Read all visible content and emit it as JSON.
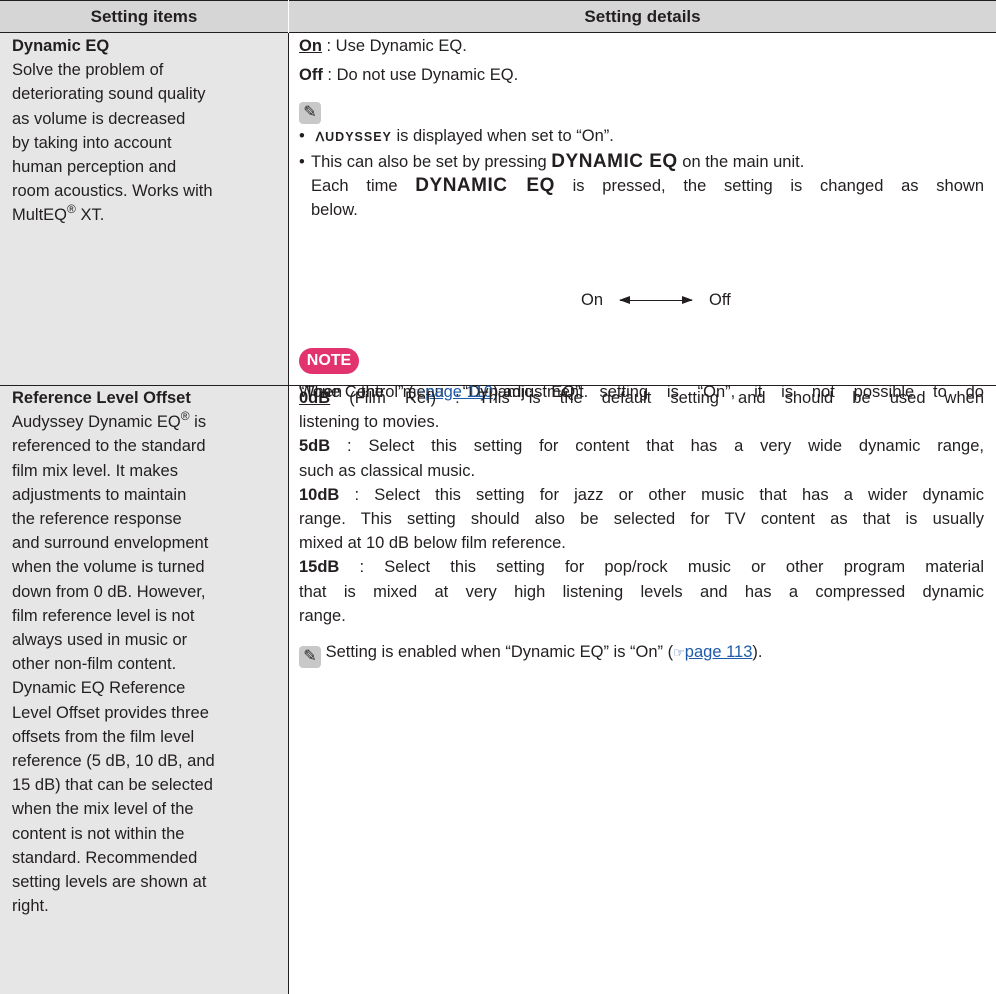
{
  "header": {
    "col1": "Setting items",
    "col2": "Setting details"
  },
  "row1": {
    "left": {
      "title": "Dynamic EQ",
      "lines": [
        "Solve the problem of",
        "deteriorating sound quality",
        "as volume is decreased",
        "by taking into account",
        "human perception and",
        "room acoustics. Works with"
      ],
      "last_pre": "MultEQ",
      "last_reg": "®",
      "last_post": " XT."
    },
    "right": {
      "on_label": "On",
      "on_text": " : Use Dynamic EQ.",
      "off_label": "Off",
      "off_text": " : Do not use Dynamic EQ.",
      "pencil_glyph": "✎",
      "bullet": "•",
      "audyssey_logo": "ᐱUDYSSEY",
      "b1_text": " is displayed when set to “On”.",
      "b2_pre": "This can also be set by pressing ",
      "b2_bold": "DYNAMIC EQ",
      "b2_post": " on the main unit.",
      "b2_l2_pre": "Each time ",
      "b2_l2_bold": "DYNAMIC EQ",
      "b2_l2_post": " is pressed, the setting is changed as shown",
      "b2_l3": "below.",
      "diagram_on": "On",
      "diagram_off": "Off",
      "note_label": "NOTE",
      "note_line1": "When the menu “Dynamic EQ” setting is “On”, it is not possible to do",
      "note_l2_pre": "“Tone Control” (",
      "note_link": "page 110",
      "note_l2_post": ") adjustment."
    }
  },
  "row2": {
    "left": {
      "title": "Reference Level Offset",
      "line1_pre": "Audyssey Dynamic EQ",
      "line1_reg": "®",
      "line1_post": " is",
      "lines": [
        "referenced to the standard",
        "film mix level. It makes",
        "adjustments to maintain",
        "the reference response",
        "and surround envelopment",
        "when the volume is turned",
        "down from 0 dB. However,",
        "film reference level is not",
        "always used in music or",
        "other non-film content.",
        "Dynamic EQ Reference",
        "Level Offset provides three",
        "offsets from the film level",
        "reference (5 dB, 10 dB, and",
        "15 dB) that can be selected",
        "when the mix level of the",
        "content is not within the",
        "standard. Recommended",
        "setting levels are shown at",
        "right."
      ]
    },
    "right": {
      "o0_label": "0dB",
      "o0_l1": " (Film Ref) : This is the default setting and should be used when",
      "o0_l2": "listening to movies.",
      "o5_label": "5dB",
      "o5_l1": " : Select this setting for content that has a very wide dynamic range,",
      "o5_l2": "such as classical music.",
      "o10_label": "10dB",
      "o10_l1": " : Select this setting for jazz or other music that has a wider dynamic",
      "o10_l2": "range. This setting should also be selected for TV content as that is usually",
      "o10_l3": "mixed at 10 dB below film reference.",
      "o15_label": "15dB",
      "o15_l1": " : Select this setting for pop/rock music or other program material",
      "o15_l2": "that is mixed at very high listening levels and has a compressed dynamic",
      "o15_l3": "range.",
      "tip_pre": " Setting is enabled when “Dynamic EQ” is “On” (",
      "tip_link": "page 113",
      "tip_post": ")."
    }
  },
  "icons": {
    "page_ref": "☞"
  },
  "colors": {
    "header_bg": "#d6d6d6",
    "left_col_bg": "#e6e6e6",
    "note_badge": "#e2336e",
    "link": "#1e5ba8"
  }
}
